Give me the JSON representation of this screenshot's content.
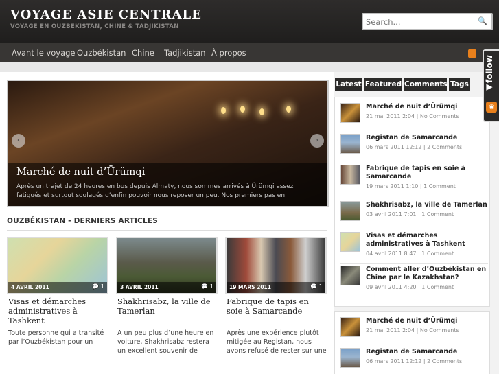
{
  "site": {
    "title": "VOYAGE ASIE CENTRALE",
    "description": "VOYAGE EN OUZBEKISTAN, CHINE & TADJIKISTAN"
  },
  "search": {
    "placeholder": "Search..."
  },
  "nav": {
    "items": [
      "Avant le voyage",
      "Ouzbékistan",
      "Chine",
      "Tadjikistan",
      "À propos"
    ]
  },
  "slider": {
    "title": "Marché de nuit d’Ürümqi",
    "text": "Après un trajet de 24 heures en bus depuis Almaty, nous sommes arrivés à Ürümqi assez fatigués et surtout soulagés d’enfin pouvoir nous reposer un peu. Nos premiers pas en…",
    "prev": "‹",
    "next": "›"
  },
  "section": {
    "title": "OUZBÉKISTAN - DERNIERS ARTICLES"
  },
  "posts": [
    {
      "date": "4 AVRIL 2011",
      "comments": "1",
      "title": "Visas et démarches administratives à Tashkent",
      "excerpt": "Toute personne qui a transité par l’Ouzbékistan pour un"
    },
    {
      "date": "3 AVRIL 2011",
      "comments": "1",
      "title": "Shakhrisabz, la ville de Tamerlan",
      "excerpt": "A un peu plus d’une heure en voiture, Shakhrisabz restera un excellent souvenir de"
    },
    {
      "date": "19 MARS 2011",
      "comments": "1",
      "title": "Fabrique de tapis en soie à Samarcande",
      "excerpt": "Après une expérience plutôt mitigée au Registan, nous avons refusé de rester sur une"
    }
  ],
  "tabs": [
    "Latest",
    "Featured",
    "Comments",
    "Tags"
  ],
  "latest": [
    {
      "title": "Marché de nuit d’Ürümqi",
      "meta": "21 mai 2011 2:04 | No Comments"
    },
    {
      "title": "Registan de Samarcande",
      "meta": "06 mars 2011 12:12 | 2 Comments"
    },
    {
      "title": "Fabrique de tapis en soie à Samarcande",
      "meta": "19 mars 2011 1:10 | 1 Comment"
    },
    {
      "title": "Shakhrisabz, la ville de Tamerlan",
      "meta": "03 avril 2011 7:01 | 1 Comment"
    },
    {
      "title": "Visas et démarches administratives à Tashkent",
      "meta": "04 avril 2011 8:47 | 1 Comment"
    },
    {
      "title": "Comment aller d’Ouzbékistan en Chine par le Kazakhstan?",
      "meta": "09 avril 2011 4:20 | 1 Comment"
    }
  ],
  "latest2": [
    {
      "title": "Marché de nuit d’Ürümqi",
      "meta": "21 mai 2011 2:04 | No Comments"
    },
    {
      "title": "Registan de Samarcande",
      "meta": "06 mars 2011 12:12 | 2 Comments"
    }
  ],
  "follow": {
    "label": "follow"
  },
  "icons": {
    "search": "search-icon",
    "rss": "rss-icon",
    "comment": "comment-icon",
    "prev": "chevron-left-icon",
    "next": "chevron-right-icon"
  },
  "colors": {
    "header": "#1f1e1d",
    "nav": "#383634",
    "tab": "#2b2a29",
    "rss": "#e8801c"
  }
}
